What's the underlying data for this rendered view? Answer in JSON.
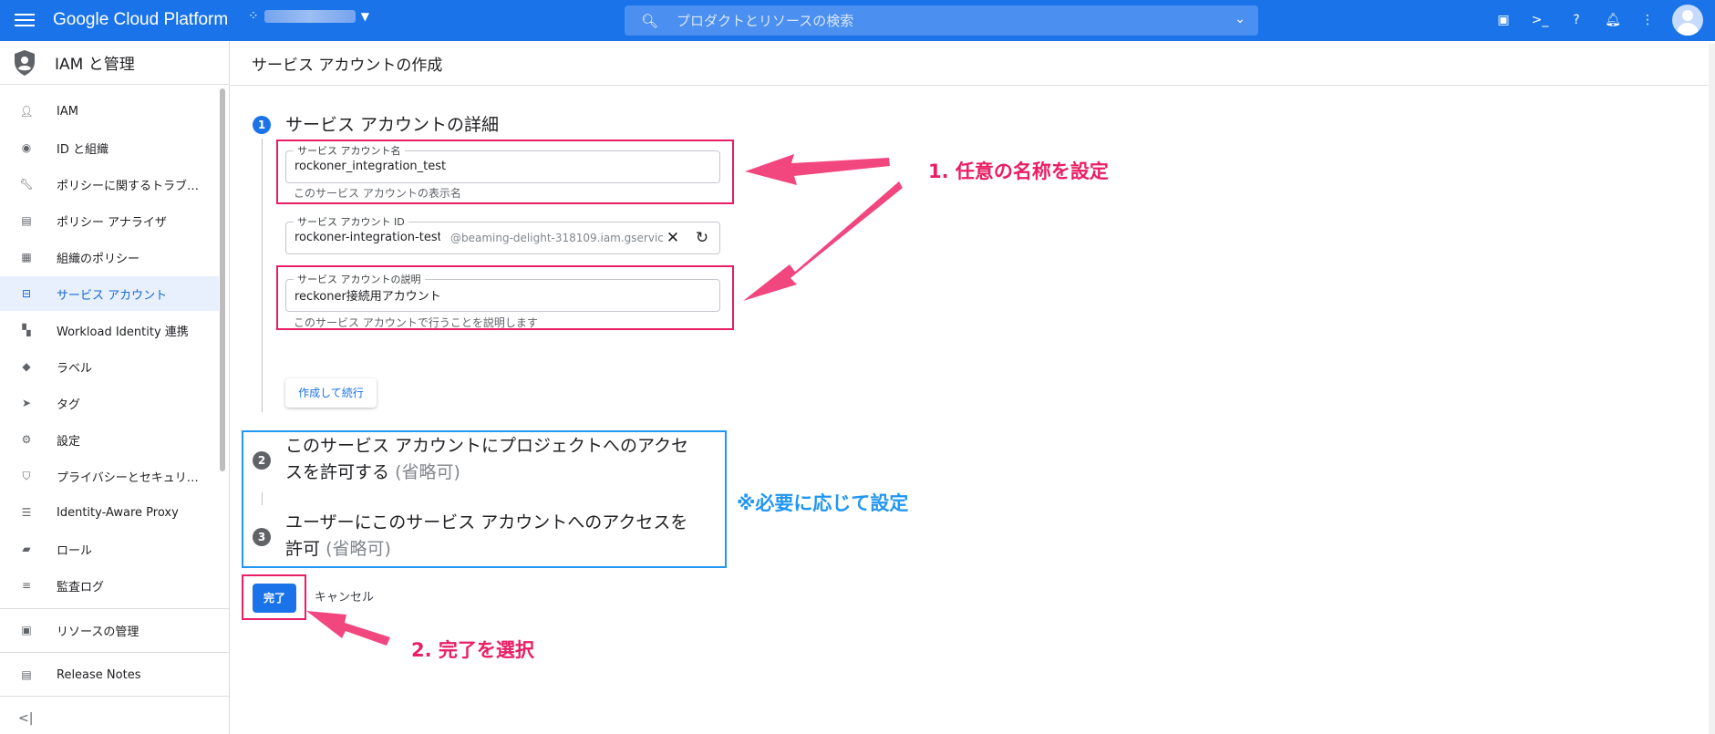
{
  "topbar": {
    "brand": "Google Cloud Platform",
    "search_placeholder": "プロダクトとリソースの検索"
  },
  "sidebar": {
    "title": "IAM と管理",
    "items": [
      {
        "label": "IAM",
        "icon": "person-add-icon"
      },
      {
        "label": "ID と組織",
        "icon": "account-circle-icon"
      },
      {
        "label": "ポリシーに関するトラブ…",
        "icon": "wrench-icon"
      },
      {
        "label": "ポリシー アナライザ",
        "icon": "document-search-icon"
      },
      {
        "label": "組織のポリシー",
        "icon": "list-doc-icon"
      },
      {
        "label": "サービス アカウント",
        "icon": "service-account-icon"
      },
      {
        "label": "Workload Identity 連携",
        "icon": "workload-icon"
      },
      {
        "label": "ラベル",
        "icon": "label-icon"
      },
      {
        "label": "タグ",
        "icon": "tag-icon"
      },
      {
        "label": "設定",
        "icon": "gear-icon"
      },
      {
        "label": "プライバシーとセキュリ…",
        "icon": "shield-icon"
      },
      {
        "label": "Identity-Aware Proxy",
        "icon": "proxy-icon"
      },
      {
        "label": "ロール",
        "icon": "hat-icon"
      },
      {
        "label": "監査ログ",
        "icon": "lines-icon"
      }
    ],
    "footer_items": [
      {
        "label": "リソースの管理",
        "icon": "folder-gear-icon"
      },
      {
        "label": "Release Notes",
        "icon": "notes-icon"
      }
    ]
  },
  "main": {
    "page_title": "サービス アカウントの作成",
    "step1": {
      "num": "1",
      "title": "サービス アカウントの詳細",
      "name_label": "サービス アカウント名",
      "name_value": "rockoner_integration_test",
      "name_hint": "このサービス アカウントの表示名",
      "id_label": "サービス アカウント ID",
      "id_value": "rockoner-integration-test",
      "id_suffix": "@beaming-delight-318109.iam.gservic",
      "desc_label": "サービス アカウントの説明",
      "desc_value": "reckoner接続用アカウント",
      "desc_hint": "このサービス アカウントで行うことを説明します",
      "continue_button": "作成して続行"
    },
    "step2": {
      "num": "2",
      "title_line1": "このサービス アカウントにプロジェクトへのアクセ",
      "title_line2": "スを許可する",
      "optional": "(省略可)"
    },
    "step3": {
      "num": "3",
      "title_line1": "ユーザーにこのサービス アカウントへのアクセスを",
      "title_line2": "許可",
      "optional": "(省略可)"
    },
    "done_button": "完了",
    "cancel_button": "キャンセル"
  },
  "annotations": {
    "note1": "1. 任意の名称を設定",
    "note_optional": "※必要に応じて設定",
    "note2": "2. 完了を選択"
  },
  "colors": {
    "brand_blue": "#1a73e8",
    "annotation_pink": "#e91e63",
    "annotation_blue": "#2196f3"
  }
}
